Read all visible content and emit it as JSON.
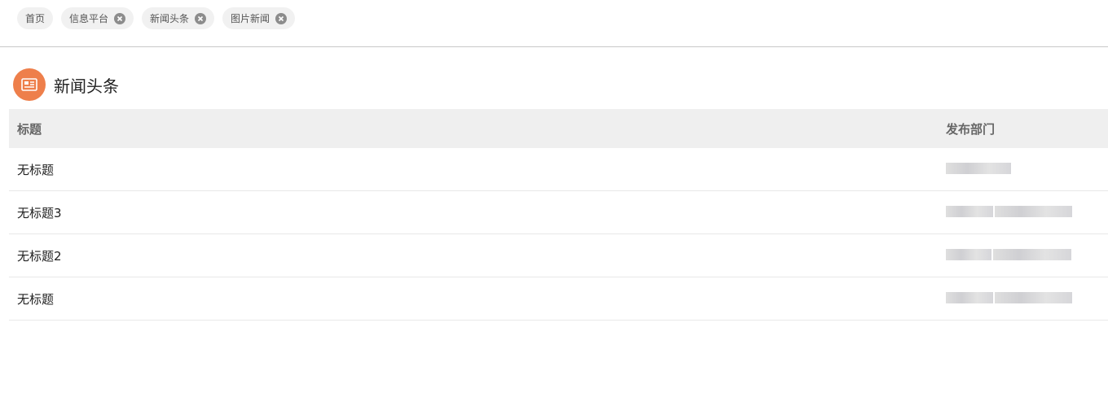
{
  "tabs": [
    {
      "label": "首页",
      "closable": false
    },
    {
      "label": "信息平台",
      "closable": true
    },
    {
      "label": "新闻头条",
      "closable": true
    },
    {
      "label": "图片新闻",
      "closable": true
    }
  ],
  "section": {
    "title": "新闻头条",
    "icon": "news-icon",
    "icon_color": "#ee7f4b"
  },
  "table": {
    "headers": {
      "title": "标题",
      "department": "发布部门"
    },
    "rows": [
      {
        "title": "无标题"
      },
      {
        "title": "无标题3"
      },
      {
        "title": "无标题2"
      },
      {
        "title": "无标题"
      }
    ]
  }
}
